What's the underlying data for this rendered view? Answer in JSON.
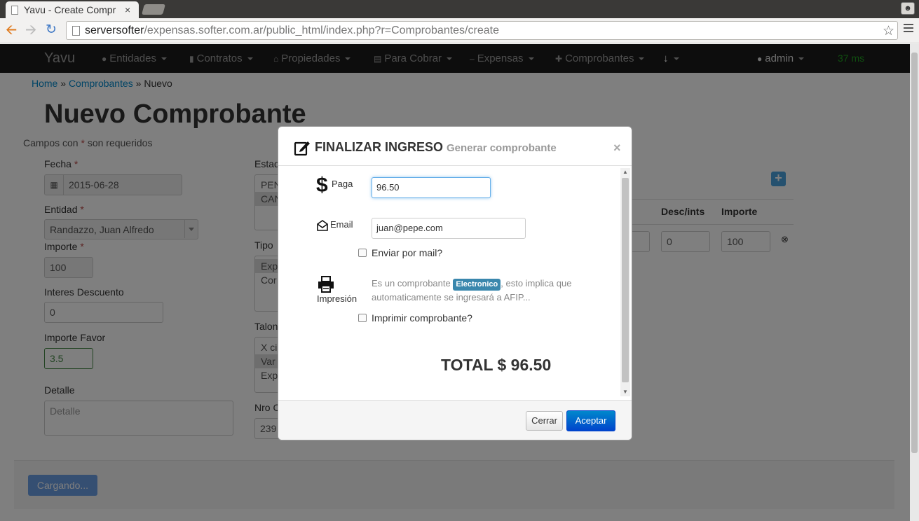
{
  "browser": {
    "tab_title": "Yavu - Create Compr",
    "tab_close": "×",
    "url_host": "serversofter",
    "url_path": "/expensas.softer.com.ar/public_html/index.php?r=Comprobantes/create"
  },
  "navbar": {
    "brand": "Yavu",
    "items": [
      {
        "label": "Entidades"
      },
      {
        "label": "Contratos"
      },
      {
        "label": "Propiedades"
      },
      {
        "label": "Para Cobrar"
      },
      {
        "label": "Expensas"
      },
      {
        "label": "Comprobantes"
      }
    ],
    "user": "admin",
    "timing": "37 ms"
  },
  "breadcrumb": {
    "home": "Home",
    "section": "Comprobantes",
    "sep": "»",
    "current": "Nuevo"
  },
  "page": {
    "title": "Nuevo Comprobante",
    "required_note_prefix": "Campos con ",
    "required_star": "*",
    "required_note_suffix": " son requeridos"
  },
  "form": {
    "fecha_label": "Fecha",
    "fecha_value": "2015-06-28",
    "entidad_label": "Entidad",
    "entidad_value": "Randazzo, Juan Alfredo",
    "importe_label": "Importe",
    "importe_value": "100",
    "interes_label": "Interes Descuento",
    "interes_value": "0",
    "favor_label": "Importe Favor",
    "favor_value": "3.5",
    "detalle_label": "Detalle",
    "detalle_placeholder": "Detalle",
    "estado_label": "Estad",
    "estado_options": [
      "PEN",
      "CAN"
    ],
    "tipo_label": "Tipo",
    "tipo_options": [
      "Exp",
      "Cor"
    ],
    "talon_label": "Talon",
    "talon_options": [
      "X ci",
      "Var",
      "Exp"
    ],
    "nro_label": "Nro C",
    "nro_value": "239"
  },
  "table": {
    "col_desc": "Desc/ints",
    "col_importe": "Importe",
    "row_desc": "0",
    "row_importe": "100"
  },
  "footer": {
    "loading_label": "Cargando..."
  },
  "modal": {
    "title": "FINALIZAR INGRESO",
    "subtitle": "Generar comprobante",
    "close": "×",
    "paga_label": "Paga",
    "paga_value": "96.50",
    "email_label": "Email",
    "email_value": "juan@pepe.com",
    "enviar_label": "Enviar por mail?",
    "impresion_label": "Impresión",
    "help_prefix": "Es un comprobante ",
    "help_badge": "Electronico",
    "help_suffix": ", esto implica que automaticamente se ingresará a AFIP...",
    "imprimir_label": "Imprimir comprobante?",
    "total": "TOTAL $ 96.50",
    "btn_cerrar": "Cerrar",
    "btn_aceptar": "Aceptar"
  }
}
